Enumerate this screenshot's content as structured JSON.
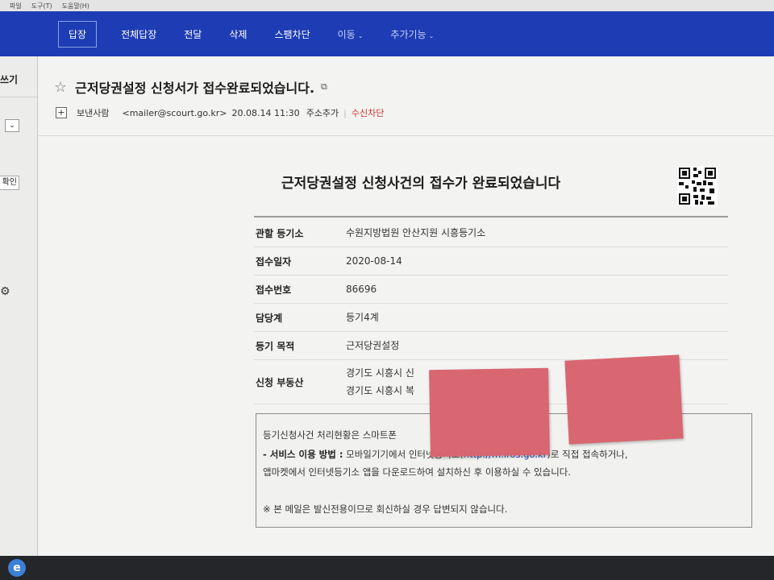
{
  "menustrip": {
    "items": [
      "파일",
      "도구(T)",
      "도움말(H)"
    ]
  },
  "toolbar": {
    "reply": "답장",
    "reply_all": "전체답장",
    "forward": "전달",
    "delete": "삭제",
    "spam_block": "스팸차단",
    "move": "이동",
    "more": "추가기능",
    "dropdown_icon": "chevron-down-icon"
  },
  "sidebar": {
    "write": "쓰기",
    "confirm_button": "확인"
  },
  "message": {
    "subject": "근저당권설정 신청서가 접수완료되었습니다.",
    "sender_label": "보낸사람",
    "sender_email": "<mailer@scourt.go.kr>",
    "date": "20.08.14 11:30",
    "add_address": "주소추가",
    "block_receive": "수신차단"
  },
  "mail_body": {
    "title": "근저당권설정 신청사건의 접수가 완료되었습니다",
    "rows": [
      {
        "label": "관할 등기소",
        "value": "수원지방법원 안산지원 시흥등기소"
      },
      {
        "label": "접수일자",
        "value": "2020-08-14"
      },
      {
        "label": "접수번호",
        "value": "86696"
      },
      {
        "label": "담당계",
        "value": "등기4계"
      },
      {
        "label": "등기 목적",
        "value": "근저당권설정"
      },
      {
        "label": "신청 부동산",
        "value": "경기도 시흥시 신",
        "value2": "경기도 시흥시 복"
      }
    ],
    "notice": {
      "line1": "등기신청사건 처리현황은 스마트폰",
      "line2_bold": "- 서비스 이용 방법 :",
      "line2_rest": " 모바일기기에서 인터넷등기소(",
      "line2_link": "http://m.iros.go.kr",
      "line2_end": ")로 직접 접속하거나,",
      "line3": "앱마켓에서 인터넷등기소 앱을 다운로드하여 설치하신 후 이용하실 수 있습니다.",
      "line4": "※ 본 메일은 발신전용이므로 회신하실 경우 답변되지 않습니다."
    }
  },
  "colors": {
    "toolbar_bg": "#1e3db4",
    "block_red": "#d0312d",
    "sticky_note": "#d8636e",
    "link_blue": "#2046b8"
  }
}
